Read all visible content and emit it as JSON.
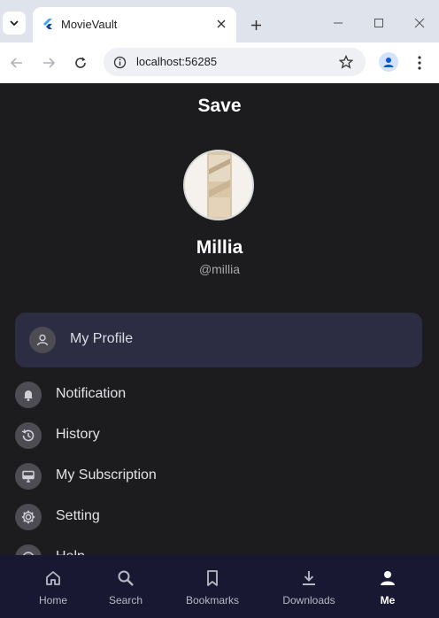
{
  "browser": {
    "tab_title": "MovieVault",
    "url": "localhost:56285"
  },
  "app": {
    "header_title": "Save",
    "user": {
      "name": "Millia",
      "handle": "@millia"
    },
    "menu": {
      "profile": "My Profile",
      "notification": "Notification",
      "history": "History",
      "subscription": "My Subscription",
      "setting": "Setting",
      "help": "Help"
    },
    "bottom_nav": {
      "home": "Home",
      "search": "Search",
      "bookmarks": "Bookmarks",
      "downloads": "Downloads",
      "me": "Me",
      "active": "me"
    }
  },
  "colors": {
    "background": "#1c1c1f",
    "highlight_card": "#2c2d42",
    "bottom_nav": "#181833"
  }
}
